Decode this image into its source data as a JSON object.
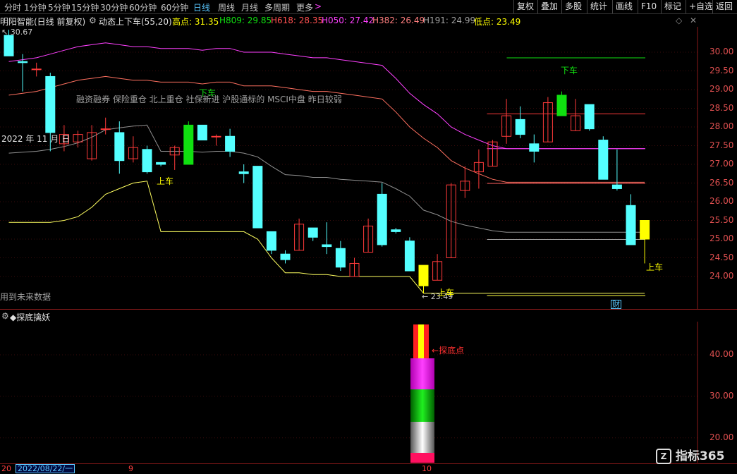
{
  "toolbar": {
    "timeframes": [
      "分时",
      "1分钟",
      "5分钟",
      "15分钟",
      "30分钟",
      "60分钟",
      "日线",
      "周线",
      "月线",
      "多周期",
      "更多"
    ],
    "active": "日线",
    "more_arrow": ">",
    "buttons": [
      "复权",
      "叠加",
      "多股",
      "统计",
      "画线",
      "F10",
      "标记",
      "+自选",
      "返回"
    ]
  },
  "info": {
    "stock": "明阳智能(日线 前复权)",
    "indicator": "动态上下车(55,20)",
    "high": "高点: 31.35",
    "h809": "H809: 29.85",
    "h618": "H618: 28.35",
    "h050": "H050: 27.42",
    "h382": "H382: 26.49",
    "h191": "H191: 24.99",
    "low": "低点: 23.49"
  },
  "colors": {
    "up": "#ff3a3a",
    "down": "#54ffff",
    "signal_green": "#10e010",
    "signal_yellow": "#ffff00",
    "high": "#ffff00",
    "h809": "#10e010",
    "h618": "#ff3a3a",
    "h050": "#ff40ff",
    "h382": "#ff6f6f",
    "h191": "#a0a0a0",
    "low": "#ffff00"
  },
  "main": {
    "max_label": "30.67",
    "min_label": "23.49",
    "year_label": "2022 年 11 月",
    "year_suffix": "日",
    "tags": "融资融券 保险重仓 北上重仓 社保新进 沪股通标的 MSCI中盘 昨日较弱",
    "future_note": "用到未来数据",
    "signal_down": "下车",
    "signal_up": "上车",
    "cai_badge": "财",
    "y_ticks": [
      "30.00",
      "29.50",
      "29.00",
      "28.50",
      "28.00",
      "27.50",
      "27.00",
      "26.50",
      "26.00",
      "25.50",
      "25.00",
      "24.50",
      "24.00"
    ]
  },
  "chart_data": {
    "type": "candlestick",
    "ylim": [
      23.6,
      30.6
    ],
    "candles": [
      {
        "o": 30.45,
        "h": 30.6,
        "l": 29.9,
        "c": 29.9
      },
      {
        "o": 29.75,
        "h": 29.95,
        "l": 28.95,
        "c": 29.72
      },
      {
        "o": 29.55,
        "h": 29.72,
        "l": 29.35,
        "c": 29.55
      },
      {
        "o": 29.35,
        "h": 29.45,
        "l": 27.35,
        "c": 27.85
      },
      {
        "o": 27.55,
        "h": 28.05,
        "l": 27.35,
        "c": 27.8
      },
      {
        "o": 27.6,
        "h": 27.9,
        "l": 27.45,
        "c": 27.8
      },
      {
        "o": 27.15,
        "h": 28.05,
        "l": 27.1,
        "c": 27.85
      },
      {
        "o": 27.95,
        "h": 28.25,
        "l": 27.8,
        "c": 27.95
      },
      {
        "o": 27.85,
        "h": 28.15,
        "l": 26.75,
        "c": 27.1
      },
      {
        "o": 27.15,
        "h": 27.75,
        "l": 27.05,
        "c": 27.45
      },
      {
        "o": 27.4,
        "h": 27.5,
        "l": 26.75,
        "c": 26.8
      },
      {
        "o": 27.05,
        "h": 27.05,
        "l": 26.95,
        "c": 27.0
      },
      {
        "o": 27.25,
        "h": 27.5,
        "l": 26.85,
        "c": 27.45
      },
      {
        "o": 27.0,
        "h": 28.15,
        "l": 27.0,
        "c": 28.05
      },
      {
        "o": 28.05,
        "h": 28.05,
        "l": 27.65,
        "c": 27.65
      },
      {
        "o": 27.75,
        "h": 27.8,
        "l": 27.5,
        "c": 27.75
      },
      {
        "o": 27.75,
        "h": 27.95,
        "l": 27.2,
        "c": 27.35
      },
      {
        "o": 26.8,
        "h": 27.0,
        "l": 26.5,
        "c": 26.75
      },
      {
        "o": 26.95,
        "h": 26.95,
        "l": 25.3,
        "c": 25.3
      },
      {
        "o": 25.2,
        "h": 25.2,
        "l": 24.6,
        "c": 24.7
      },
      {
        "o": 24.6,
        "h": 24.7,
        "l": 24.35,
        "c": 24.45
      },
      {
        "o": 24.7,
        "h": 25.55,
        "l": 24.7,
        "c": 25.4
      },
      {
        "o": 25.3,
        "h": 25.3,
        "l": 24.95,
        "c": 25.05
      },
      {
        "o": 24.85,
        "h": 25.45,
        "l": 24.6,
        "c": 24.8
      },
      {
        "o": 24.75,
        "h": 24.95,
        "l": 24.15,
        "c": 24.25
      },
      {
        "o": 24.0,
        "h": 24.5,
        "l": 24.0,
        "c": 24.35
      },
      {
        "o": 24.65,
        "h": 25.55,
        "l": 24.65,
        "c": 25.35
      },
      {
        "o": 26.2,
        "h": 26.5,
        "l": 24.8,
        "c": 24.85
      },
      {
        "o": 25.25,
        "h": 25.3,
        "l": 25.15,
        "c": 25.2
      },
      {
        "o": 24.95,
        "h": 25.05,
        "l": 24.15,
        "c": 24.15
      },
      {
        "o": 24.3,
        "h": 24.3,
        "l": 23.55,
        "c": 23.75
      },
      {
        "o": 23.9,
        "h": 24.6,
        "l": 23.9,
        "c": 24.4
      },
      {
        "o": 24.5,
        "h": 26.5,
        "l": 24.5,
        "c": 26.45
      },
      {
        "o": 26.3,
        "h": 26.95,
        "l": 26.1,
        "c": 26.55
      },
      {
        "o": 26.8,
        "h": 27.4,
        "l": 26.35,
        "c": 27.05
      },
      {
        "o": 26.95,
        "h": 27.65,
        "l": 26.95,
        "c": 27.6
      },
      {
        "o": 27.75,
        "h": 28.75,
        "l": 27.55,
        "c": 28.3
      },
      {
        "o": 28.2,
        "h": 28.55,
        "l": 27.7,
        "c": 27.8
      },
      {
        "o": 27.55,
        "h": 27.8,
        "l": 27.05,
        "c": 27.35
      },
      {
        "o": 27.6,
        "h": 28.8,
        "l": 27.6,
        "c": 28.65
      },
      {
        "o": 28.85,
        "h": 28.95,
        "l": 28.3,
        "c": 28.3
      },
      {
        "o": 27.9,
        "h": 28.75,
        "l": 27.9,
        "c": 28.3
      },
      {
        "o": 28.6,
        "h": 28.6,
        "l": 27.9,
        "c": 27.95
      },
      {
        "o": 27.65,
        "h": 27.75,
        "l": 26.6,
        "c": 26.6
      },
      {
        "o": 26.45,
        "h": 27.4,
        "l": 26.3,
        "c": 26.35
      },
      {
        "o": 25.9,
        "h": 26.2,
        "l": 24.85,
        "c": 24.85
      },
      {
        "o": 25.0,
        "h": 25.5,
        "l": 24.35,
        "c": 25.5
      }
    ],
    "signal_green_index": [
      13,
      40
    ],
    "signal_yellow_index": [
      30,
      46
    ],
    "levels": {
      "high": 31.35,
      "h809": 29.85,
      "h618": 28.35,
      "h050": 27.42,
      "h382": 26.49,
      "h191": 24.99,
      "low": 23.49
    },
    "upper_band": [
      29.75,
      29.8,
      29.85,
      29.95,
      30.05,
      30.15,
      30.2,
      30.25,
      30.2,
      30.15,
      30.15,
      30.1,
      30.1,
      30.1,
      30.05,
      30.1,
      30.1,
      30.0,
      30.0,
      30.0,
      29.95,
      29.9,
      29.85,
      29.85,
      29.8,
      29.75,
      29.7,
      29.65,
      29.3,
      28.9,
      28.6,
      28.35,
      28.0,
      27.8,
      27.65,
      27.5,
      27.42,
      27.42,
      27.42,
      27.42,
      27.42,
      27.42,
      27.42,
      27.42,
      27.42,
      27.42,
      27.42
    ],
    "lower_band": [
      25.45,
      25.45,
      25.45,
      25.45,
      25.5,
      25.6,
      25.85,
      26.2,
      26.35,
      26.5,
      26.55,
      25.2,
      25.2,
      25.2,
      25.2,
      25.2,
      25.2,
      25.2,
      25.0,
      24.5,
      24.1,
      24.1,
      24.05,
      24.05,
      24.0,
      24.0,
      24.0,
      24.0,
      24.0,
      24.0,
      23.55,
      23.55,
      23.55,
      23.55,
      23.55,
      23.55,
      23.55,
      23.55,
      23.55,
      23.55,
      23.55,
      23.55,
      23.55,
      23.55,
      23.55,
      23.55,
      23.55
    ]
  },
  "sub": {
    "title": "◆探底擒妖",
    "marker": "探底点",
    "y_ticks": [
      "40.00",
      "30.00",
      "20.00"
    ]
  },
  "dates": {
    "left_stub": "20",
    "date_box": "2022/08/22/一",
    "month_a": "9",
    "month_b": "10"
  },
  "logo": {
    "number": "365",
    "text": "指标"
  }
}
